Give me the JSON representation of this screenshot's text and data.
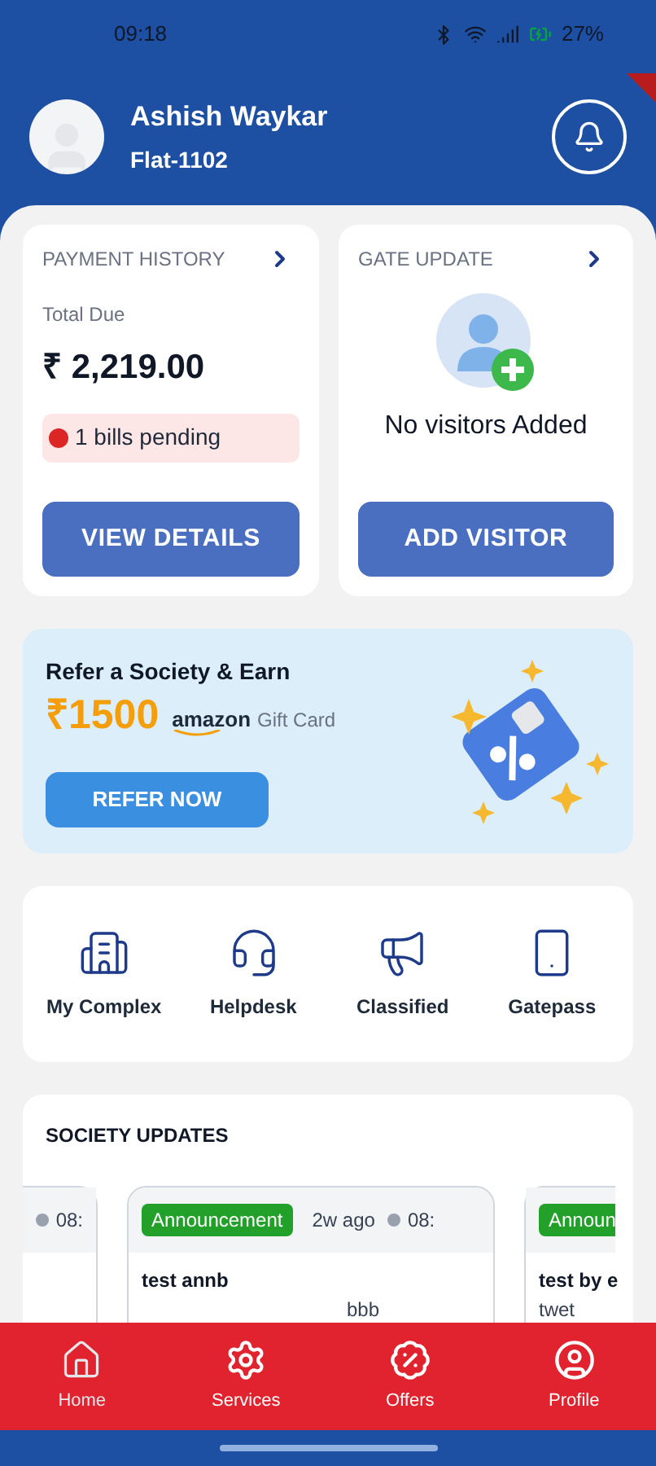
{
  "status_bar": {
    "time": "09:18",
    "battery": "27%"
  },
  "header": {
    "name": "Ashish Waykar",
    "flat": "Flat-1102"
  },
  "payment": {
    "title": "PAYMENT HISTORY",
    "label": "Total Due",
    "amount": "₹ 2,219.00",
    "pending": "1 bills pending",
    "button": "VIEW DETAILS"
  },
  "gate": {
    "title": "GATE UPDATE",
    "empty": "No visitors Added",
    "button": "ADD VISITOR"
  },
  "referral": {
    "title": "Refer a Society & Earn",
    "amount": "₹1500",
    "brand": "amazon",
    "reward": "Gift Card",
    "button": "REFER NOW"
  },
  "quick_links": [
    {
      "kind": "complex",
      "label": "My Complex"
    },
    {
      "kind": "helpdesk",
      "label": "Helpdesk"
    },
    {
      "kind": "classified",
      "label": "Classified"
    },
    {
      "kind": "gatepass",
      "label": "Gatepass"
    }
  ],
  "society_updates": {
    "title": "SOCIETY UPDATES",
    "cards": [
      {
        "kind": "partial_left",
        "time": "08:"
      },
      {
        "kind": "full",
        "tag": "Announcement",
        "ago": "2w ago",
        "time": "08:",
        "title": "test annb",
        "body": "bbb"
      },
      {
        "kind": "partial_right",
        "tag": "Announ",
        "title": "test by e",
        "body": "twet"
      }
    ]
  },
  "nav": [
    {
      "kind": "home",
      "label": "Home",
      "selected": true
    },
    {
      "kind": "services",
      "label": "Services",
      "selected": false
    },
    {
      "kind": "offers",
      "label": "Offers",
      "selected": false
    },
    {
      "kind": "profile",
      "label": "Profile",
      "selected": false
    }
  ]
}
